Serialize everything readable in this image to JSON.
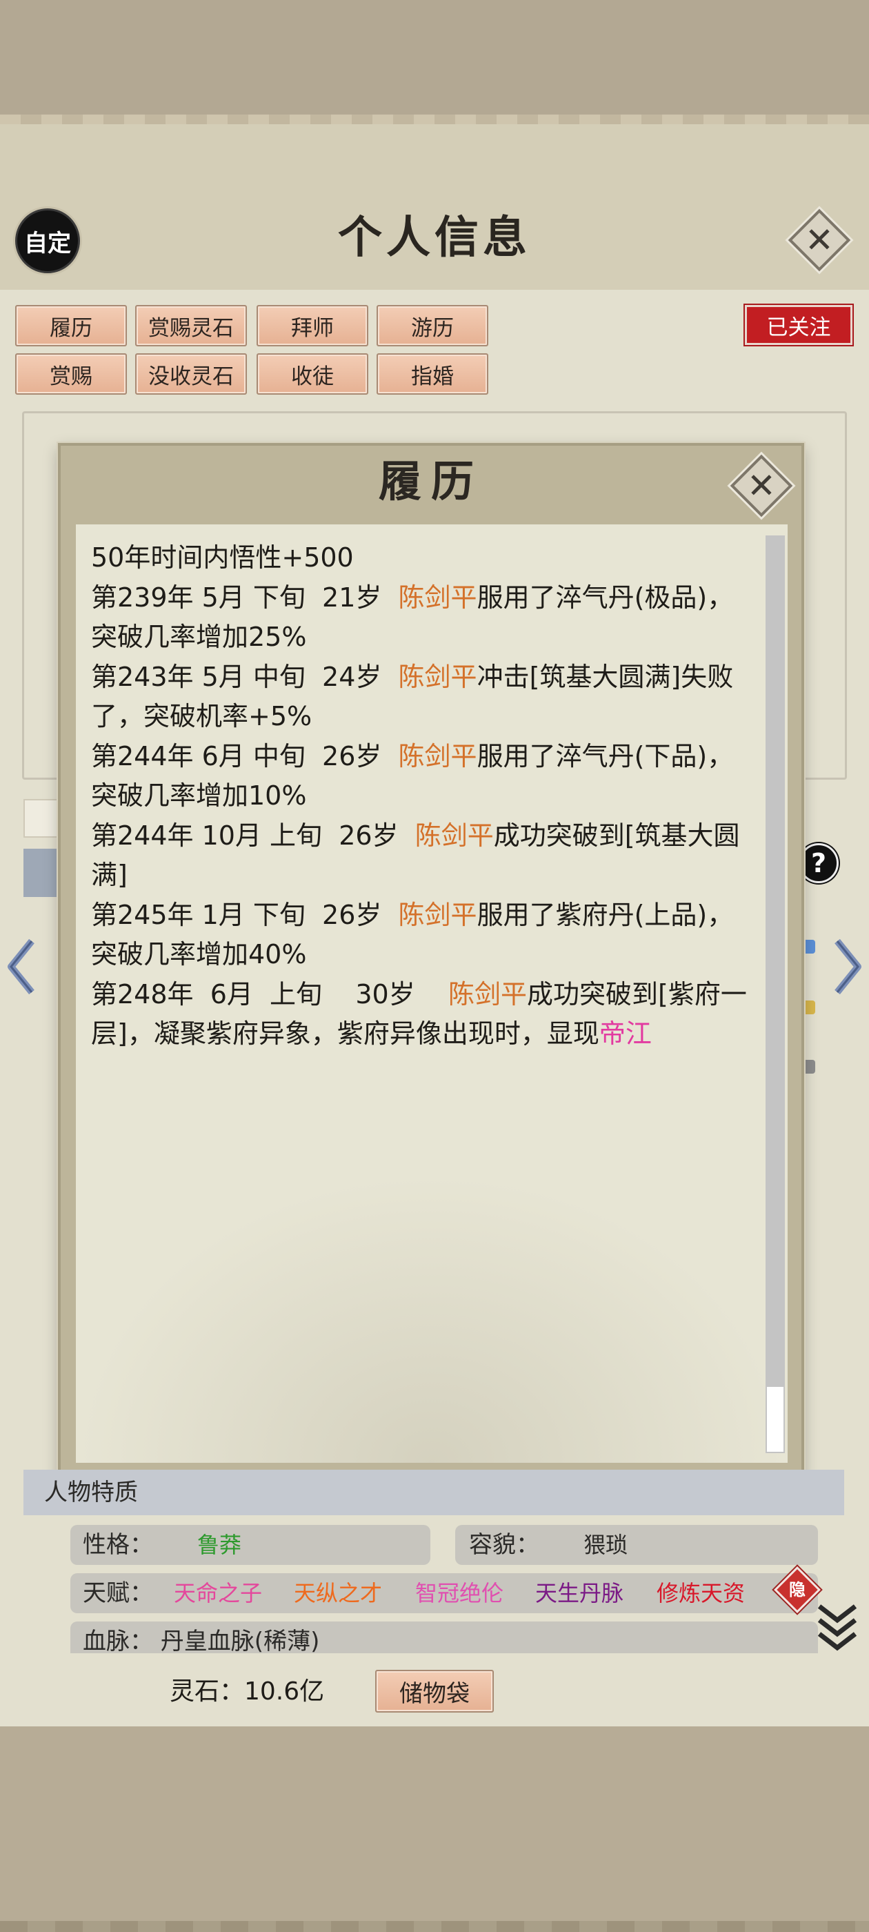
{
  "header": {
    "auto_label": "自定",
    "title": "个人信息"
  },
  "actions": {
    "row1": [
      "履历",
      "赏赐灵石",
      "拜师",
      "游历"
    ],
    "row2": [
      "赏赐",
      "没收灵石",
      "收徒",
      "指婚"
    ],
    "follow_label": "已关注"
  },
  "modal": {
    "title": "履历",
    "lines": [
      {
        "parts": [
          {
            "t": "50年时间内悟性+500"
          }
        ]
      },
      {
        "parts": [
          {
            "t": "第239年 5月 下旬  21岁  "
          },
          {
            "t": "陈剑平",
            "c": "hl"
          },
          {
            "t": "服用了淬气丹(极品)，"
          }
        ]
      },
      {
        "parts": [
          {
            "t": "突破几率增加25%"
          }
        ]
      },
      {
        "parts": [
          {
            "t": "第243年 5月 中旬  24岁  "
          },
          {
            "t": "陈剑平",
            "c": "hl"
          },
          {
            "t": "冲击[筑基大圆满]失败"
          }
        ]
      },
      {
        "parts": [
          {
            "t": "了，突破机率+5%"
          }
        ]
      },
      {
        "parts": [
          {
            "t": "第244年 6月 中旬  26岁  "
          },
          {
            "t": "陈剑平",
            "c": "hl"
          },
          {
            "t": "服用了淬气丹(下品)，"
          }
        ]
      },
      {
        "parts": [
          {
            "t": "突破几率增加10%"
          }
        ]
      },
      {
        "parts": [
          {
            "t": "第244年 10月 上旬  26岁  "
          },
          {
            "t": "陈剑平",
            "c": "hl"
          },
          {
            "t": "成功突破到[筑基大圆"
          }
        ]
      },
      {
        "parts": [
          {
            "t": "满]"
          }
        ]
      },
      {
        "parts": [
          {
            "t": "第245年 1月 下旬  26岁  "
          },
          {
            "t": "陈剑平",
            "c": "hl"
          },
          {
            "t": "服用了紫府丹(上品)，"
          }
        ]
      },
      {
        "parts": [
          {
            "t": "突破几率增加40%"
          }
        ]
      },
      {
        "parts": [
          {
            "t": "第248年  6月  上旬    30岁    "
          },
          {
            "t": "陈剑平",
            "c": "hl"
          },
          {
            "t": "成功突破到[紫府一"
          }
        ]
      },
      {
        "parts": [
          {
            "t": "层]，凝聚紫府异象，紫府异像出现时，显现"
          },
          {
            "t": "帝江",
            "c": "pink"
          }
        ]
      }
    ]
  },
  "traits": {
    "title": "人物特质",
    "personality_label": "性格：",
    "personality_value": "鲁莽",
    "appearance_label": "容貌：",
    "appearance_value": "猥琐",
    "talent_label": "天赋：",
    "talents": [
      {
        "name": "天命之子",
        "color": "#e4489c"
      },
      {
        "name": "天纵之才",
        "color": "#ee6a1e"
      },
      {
        "name": "智冠绝伦",
        "color": "#e04fb0"
      },
      {
        "name": "天生丹脉",
        "color": "#7b1a86"
      },
      {
        "name": "修炼天资",
        "color": "#d8182a"
      }
    ],
    "hide_label": "隐",
    "bloodline_text": "血脉：   丹皇血脉(稀薄)"
  },
  "footer": {
    "spirit_stone": "灵石：10.6亿",
    "storage_label": "储物袋"
  },
  "colors": {
    "highlight_name": "#d4712a",
    "follow_red": "#c21e22",
    "personality_green": "#2e9a2e"
  }
}
